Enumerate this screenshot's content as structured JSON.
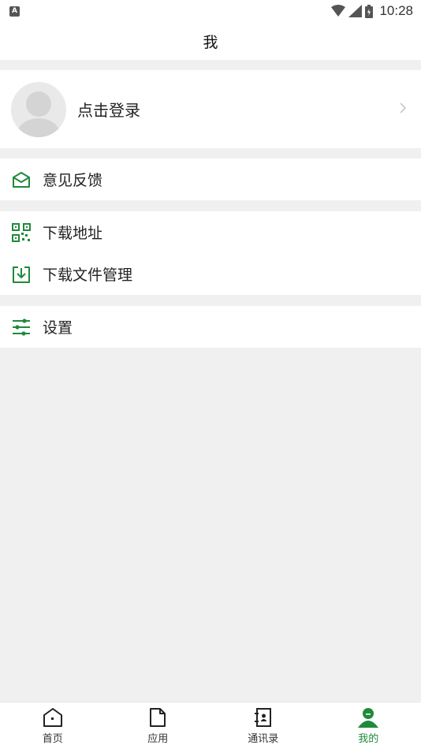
{
  "status_bar": {
    "notification": "A",
    "time": "10:28"
  },
  "header": {
    "title": "我"
  },
  "profile": {
    "login_label": "点击登录"
  },
  "menu": {
    "feedback": "意见反馈",
    "download_address": "下载地址",
    "download_manager": "下载文件管理",
    "settings": "设置"
  },
  "tabs": [
    {
      "label": "首页",
      "icon": "home-icon"
    },
    {
      "label": "应用",
      "icon": "file-icon"
    },
    {
      "label": "通讯录",
      "icon": "contacts-icon"
    },
    {
      "label": "我的",
      "icon": "person-icon"
    }
  ],
  "colors": {
    "accent": "#1f8a3a",
    "background": "#f0f0f0"
  }
}
